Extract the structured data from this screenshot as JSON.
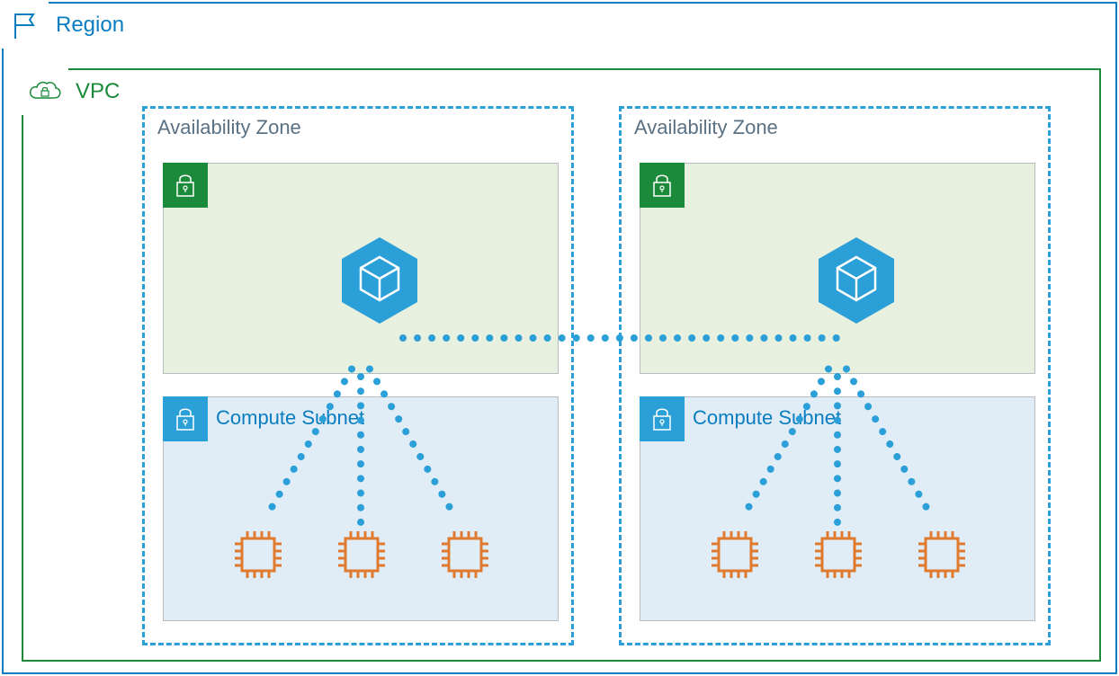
{
  "region": {
    "label": "Region"
  },
  "vpc": {
    "label": "VPC"
  },
  "availability_zones": [
    {
      "label": "Availability Zone",
      "compute_subnet_label": "Compute Subnet"
    },
    {
      "label": "Availability Zone",
      "compute_subnet_label": "Compute Subnet"
    }
  ],
  "colors": {
    "region_border": "#0a7dc0",
    "vpc_border": "#1b8a3a",
    "az_border": "#2b9fd8",
    "subnet_green_bg": "#e8f0df",
    "subnet_blue_bg": "#e1edf6",
    "chip_orange": "#e07a2e",
    "hex_blue": "#2b9fd8"
  }
}
